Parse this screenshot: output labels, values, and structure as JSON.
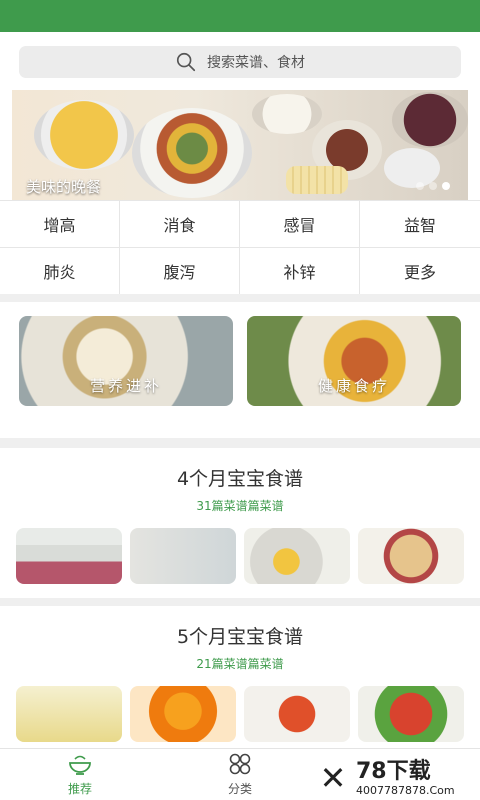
{
  "search": {
    "placeholder": "搜索菜谱、食材"
  },
  "banner": {
    "caption": "美味的晚餐",
    "dots": 3,
    "active_dot": 3
  },
  "categories": [
    "增高",
    "消食",
    "感冒",
    "益智",
    "肺炎",
    "腹泻",
    "补锌",
    "更多"
  ],
  "promos": [
    {
      "label": "营养进补"
    },
    {
      "label": "健康食疗"
    }
  ],
  "sections": [
    {
      "title": "4个月宝宝食谱",
      "subtitle": "31篇菜谱篇菜谱"
    },
    {
      "title": "5个月宝宝食谱",
      "subtitle": "21篇菜谱篇菜谱"
    }
  ],
  "tabs": [
    {
      "label": "推荐",
      "icon": "bowl-icon",
      "active": true
    },
    {
      "label": "分类",
      "icon": "grid-icon",
      "active": false
    }
  ],
  "watermark": {
    "name": "78下载",
    "url": "4007787878.Com"
  },
  "colors": {
    "accent": "#3f9b4c"
  }
}
